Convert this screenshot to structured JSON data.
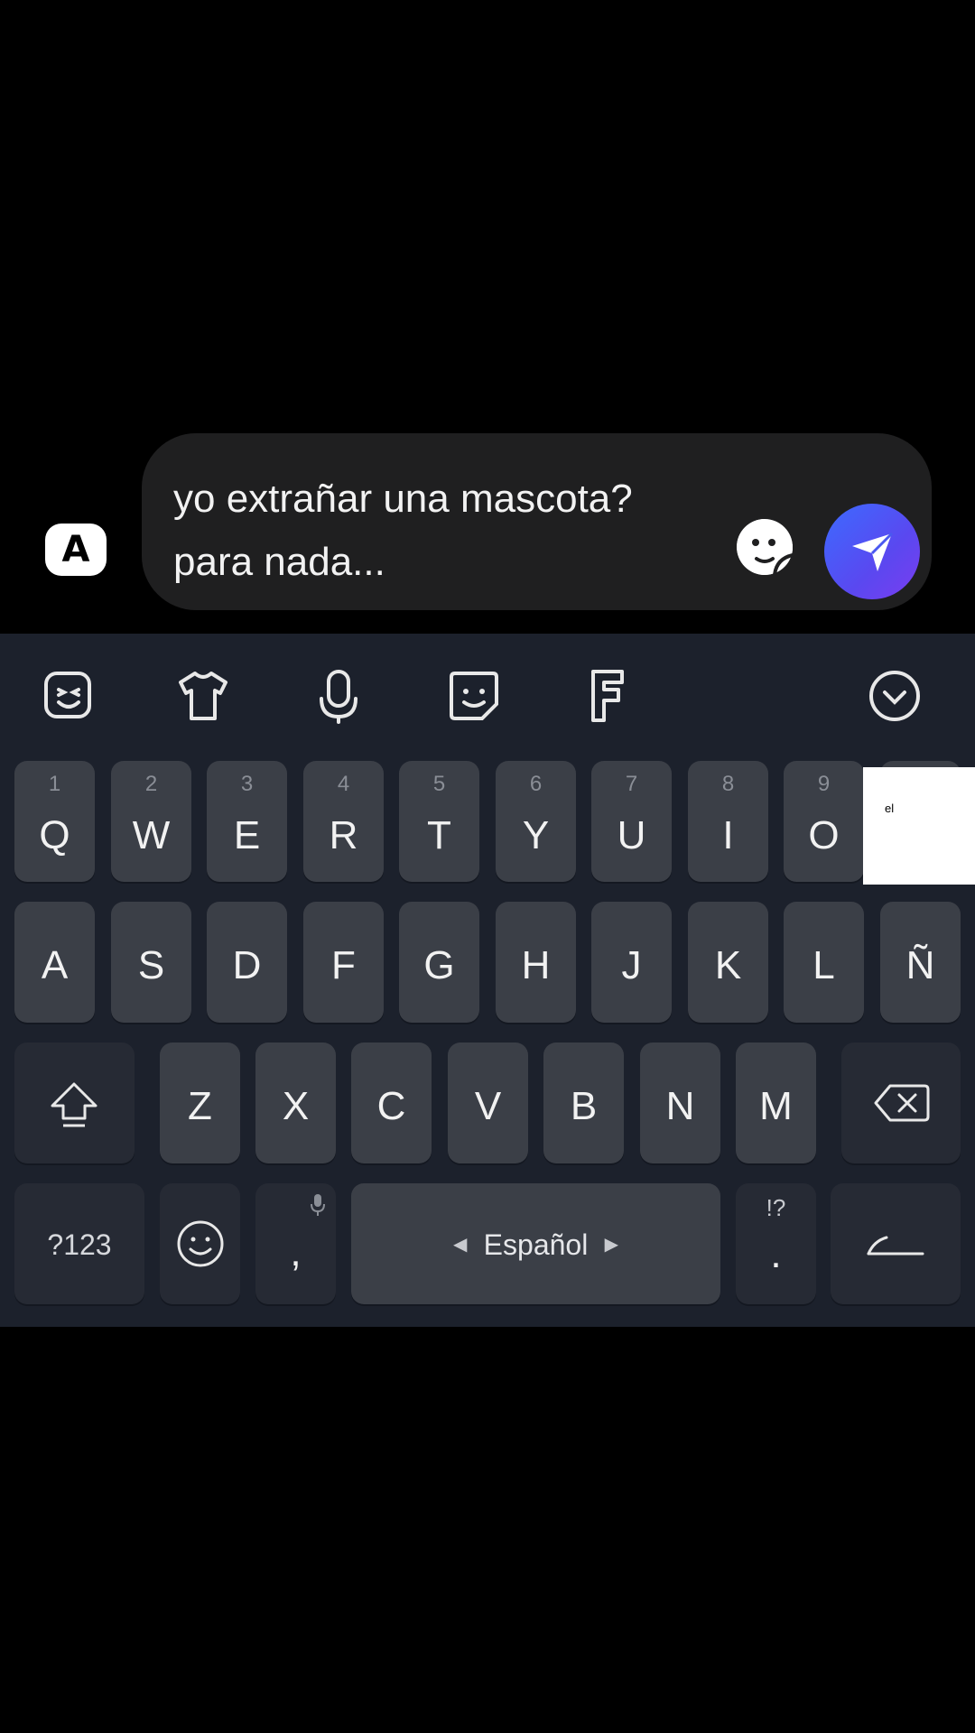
{
  "compose": {
    "avatar_letter": "A",
    "text": "yo extrañar una mascota?\npara nada..."
  },
  "toolbar": {
    "icons": [
      "emoji-face-icon",
      "tshirt-theme-icon",
      "microphone-icon",
      "sticker-icon",
      "font-f-icon",
      "collapse-chevron-icon"
    ]
  },
  "keyboard": {
    "row1": [
      {
        "label": "Q",
        "hint": "1"
      },
      {
        "label": "W",
        "hint": "2"
      },
      {
        "label": "E",
        "hint": "3"
      },
      {
        "label": "R",
        "hint": "4"
      },
      {
        "label": "T",
        "hint": "5"
      },
      {
        "label": "Y",
        "hint": "6"
      },
      {
        "label": "U",
        "hint": "7"
      },
      {
        "label": "I",
        "hint": "8"
      },
      {
        "label": "O",
        "hint": "9"
      }
    ],
    "row2": [
      "A",
      "S",
      "D",
      "F",
      "G",
      "H",
      "J",
      "K",
      "L",
      "Ñ"
    ],
    "row3": [
      "Z",
      "X",
      "C",
      "V",
      "B",
      "N",
      "M"
    ],
    "symbols_label": "?123",
    "comma_label": ",",
    "space_label": "Español",
    "period_label": ".",
    "period_hint": "!?"
  },
  "suggestion": {
    "text": "el"
  }
}
